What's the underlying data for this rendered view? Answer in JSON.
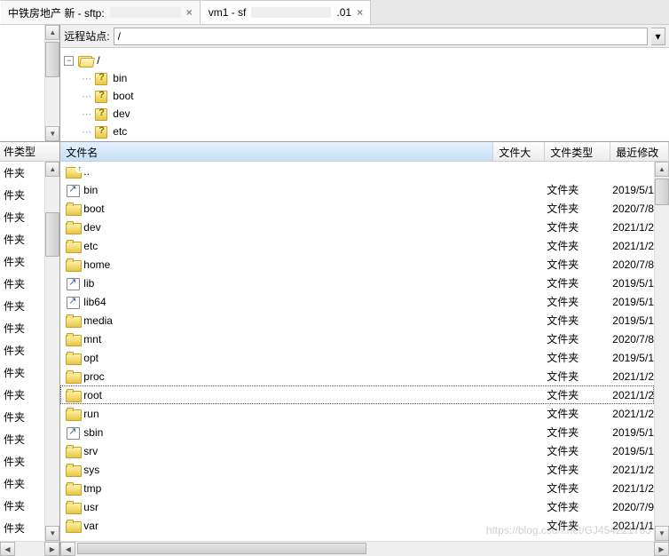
{
  "tabs": [
    {
      "label": "中铁房地产 新 - sftp:",
      "active": false
    },
    {
      "label": "vm1 - sf",
      "suffix": ".01",
      "active": true
    }
  ],
  "remote": {
    "label": "远程站点:",
    "path": "/"
  },
  "tree": {
    "root_label": "/",
    "items": [
      {
        "label": "bin"
      },
      {
        "label": "boot"
      },
      {
        "label": "dev"
      },
      {
        "label": "etc"
      }
    ]
  },
  "left_panel": {
    "header": "件类型",
    "items": [
      "件夹",
      "件夹",
      "件夹",
      "件夹",
      "件夹",
      "件夹",
      "件夹",
      "件夹",
      "件夹",
      "件夹",
      "件夹",
      "件夹",
      "件夹",
      "件夹",
      "件夹",
      "件夹",
      "件夹"
    ]
  },
  "columns": {
    "name": "文件名",
    "size": "文件大小",
    "type": "文件类型",
    "date": "最近修改"
  },
  "file_type_folder": "文件夹",
  "files": [
    {
      "name": "..",
      "icon": "up",
      "type": "",
      "date": ""
    },
    {
      "name": "bin",
      "icon": "link",
      "type": "文件夹",
      "date": "2019/5/1"
    },
    {
      "name": "boot",
      "icon": "folder",
      "type": "文件夹",
      "date": "2020/7/8"
    },
    {
      "name": "dev",
      "icon": "folder",
      "type": "文件夹",
      "date": "2021/1/2"
    },
    {
      "name": "etc",
      "icon": "folder",
      "type": "文件夹",
      "date": "2021/1/2"
    },
    {
      "name": "home",
      "icon": "folder",
      "type": "文件夹",
      "date": "2020/7/8"
    },
    {
      "name": "lib",
      "icon": "link",
      "type": "文件夹",
      "date": "2019/5/1"
    },
    {
      "name": "lib64",
      "icon": "link",
      "type": "文件夹",
      "date": "2019/5/1"
    },
    {
      "name": "media",
      "icon": "folder",
      "type": "文件夹",
      "date": "2019/5/1"
    },
    {
      "name": "mnt",
      "icon": "folder",
      "type": "文件夹",
      "date": "2020/7/8"
    },
    {
      "name": "opt",
      "icon": "folder",
      "type": "文件夹",
      "date": "2019/5/1"
    },
    {
      "name": "proc",
      "icon": "folder",
      "type": "文件夹",
      "date": "2021/1/2"
    },
    {
      "name": "root",
      "icon": "folder",
      "type": "文件夹",
      "date": "2021/1/2",
      "selected": true
    },
    {
      "name": "run",
      "icon": "folder",
      "type": "文件夹",
      "date": "2021/1/2"
    },
    {
      "name": "sbin",
      "icon": "link",
      "type": "文件夹",
      "date": "2019/5/1"
    },
    {
      "name": "srv",
      "icon": "folder",
      "type": "文件夹",
      "date": "2019/5/1"
    },
    {
      "name": "sys",
      "icon": "folder",
      "type": "文件夹",
      "date": "2021/1/2"
    },
    {
      "name": "tmp",
      "icon": "folder",
      "type": "文件夹",
      "date": "2021/1/2"
    },
    {
      "name": "usr",
      "icon": "folder",
      "type": "文件夹",
      "date": "2020/7/9"
    },
    {
      "name": "var",
      "icon": "folder",
      "type": "文件夹",
      "date": "2021/1/1"
    }
  ],
  "watermark": "https://blog.csdn.net/GJ454221763"
}
